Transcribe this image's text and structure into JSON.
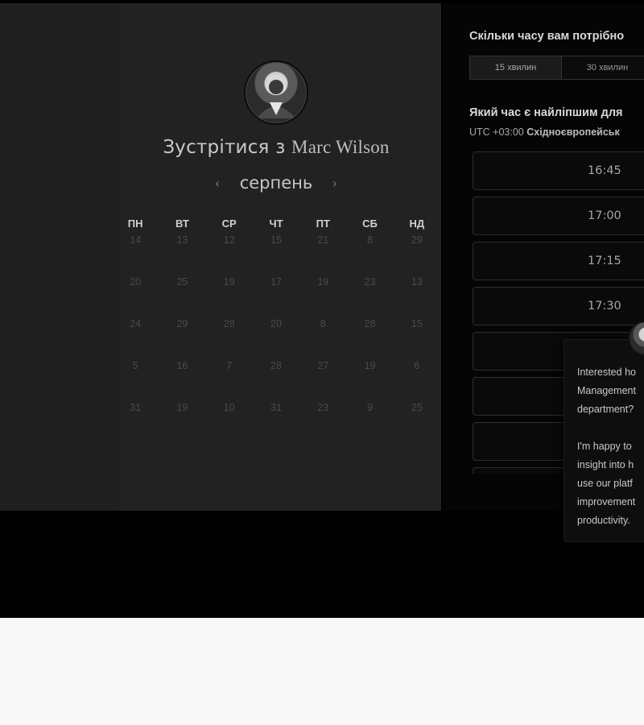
{
  "scheduler": {
    "title_prefix": "Зустрітися з",
    "host_name": "Marc Wilson",
    "month": "серпень",
    "prev_icon": "chevron-left-icon",
    "next_icon": "chevron-right-icon",
    "weekdays": [
      "ПН",
      "ВТ",
      "СР",
      "ЧТ",
      "ПТ",
      "СБ",
      "НД"
    ],
    "weeks": [
      [
        "14",
        "13",
        "12",
        "15",
        "21",
        "8",
        "29"
      ],
      [
        "20",
        "25",
        "19",
        "17",
        "19",
        "23",
        "13"
      ],
      [
        "24",
        "29",
        "28",
        "20",
        "8",
        "28",
        "15"
      ],
      [
        "5",
        "16",
        "7",
        "28",
        "27",
        "19",
        "6"
      ],
      [
        "31",
        "19",
        "10",
        "31",
        "23",
        "9",
        "25"
      ]
    ]
  },
  "booking": {
    "duration_title": "Скільки часу вам потрібно",
    "durations": [
      "15 хвилин",
      "30 хвилин"
    ],
    "time_title": "Який час є найліпшим для",
    "tz_offset": "UTC +03:00",
    "tz_name": "Східноєвропейськ",
    "slots": [
      "16:45",
      "17:00",
      "17:15",
      "17:30",
      "",
      "",
      "",
      ""
    ]
  },
  "chat": {
    "lines": [
      "Interested ho",
      "Management",
      "department?",
      "",
      "I'm happy to",
      "insight into h",
      "use our platf",
      "improvement",
      "productivity."
    ]
  },
  "colors": {
    "page_bg": "#f8f8f8",
    "app_bg": "#000000",
    "panel_bg": "#222222",
    "text": "#c9c9c9"
  }
}
